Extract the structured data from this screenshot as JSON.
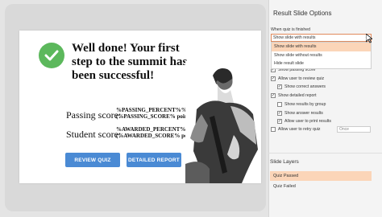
{
  "slide": {
    "headline": "Well done! Your first step to the summit has been successful!",
    "passing_label": "Passing score:",
    "passing_vars": [
      "%PASSING_PERCENT%%",
      "(%PASSING_SCORE% points)"
    ],
    "student_label": "Student score:",
    "student_vars": [
      "%AWARDED_PERCENT%%",
      "(%AWARDED_SCORE% points)"
    ],
    "review_button": "REVIEW QUIZ",
    "report_button": "DETAILED REPORT"
  },
  "panel": {
    "title": "Result Slide Options",
    "when_finished_label": "When quiz is finished",
    "selected_option": "Show slide with results",
    "dropdown_options": [
      "Show slide with results",
      "Show slide without results",
      "Hide result slide"
    ],
    "checkboxes": [
      {
        "label": "Show passing score",
        "checked": true
      },
      {
        "label": "Allow user to review quiz",
        "checked": true
      },
      {
        "label": "Show correct answers",
        "checked": true
      },
      {
        "label": "Show detailed report",
        "checked": true
      },
      {
        "label": "Show results by group",
        "checked": false
      },
      {
        "label": "Show answer results",
        "checked": true
      },
      {
        "label": "Allow user to print results",
        "checked": true
      },
      {
        "label": "Allow user to retry quiz",
        "checked": false
      }
    ],
    "retry_select": "Once",
    "layers_title": "Slide Layers",
    "layers": [
      {
        "label": "Quiz Passed",
        "active": true
      },
      {
        "label": "Quiz Failed",
        "active": false
      }
    ]
  },
  "colors": {
    "accent": "#4a8ad4",
    "success": "#5cb85c",
    "highlight": "#fbd5b8",
    "focus_border": "#e08a5c"
  }
}
